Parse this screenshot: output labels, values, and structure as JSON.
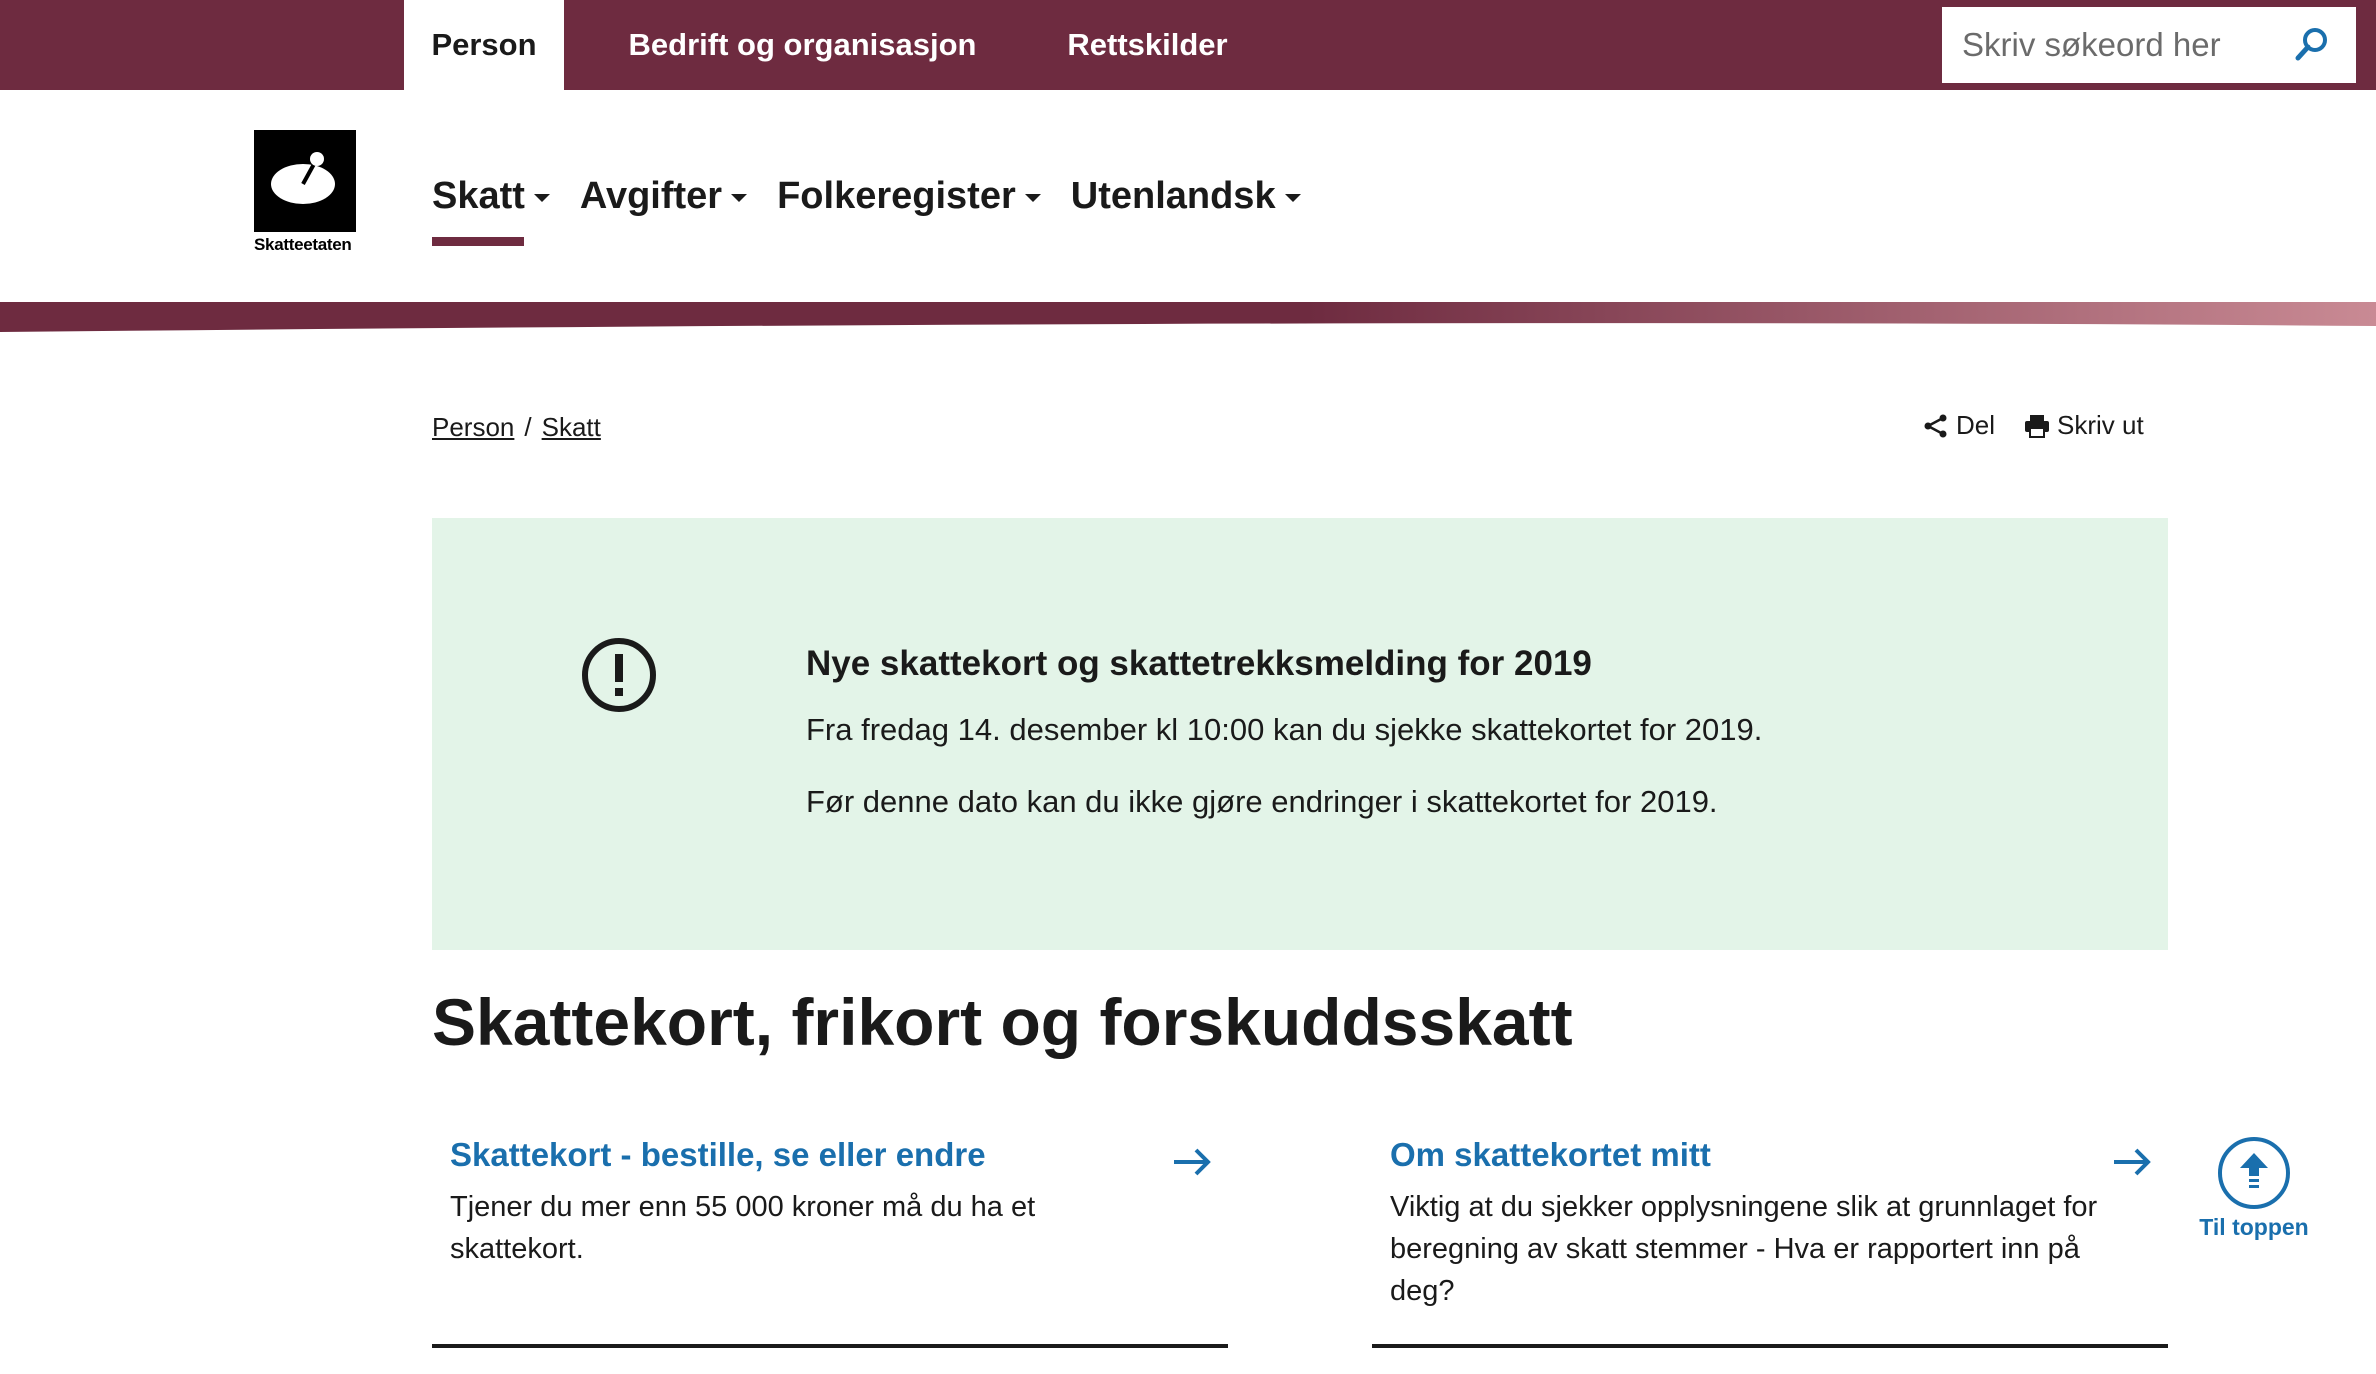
{
  "top_nav": {
    "tabs": [
      {
        "label": "Person",
        "active": true
      },
      {
        "label": "Bedrift og organisasjon",
        "active": false
      },
      {
        "label": "Rettskilder",
        "active": false
      }
    ],
    "search_placeholder": "Skriv søkeord her",
    "search_icon": "search-icon"
  },
  "logo": {
    "text": "Skatteetaten"
  },
  "main_nav": {
    "items": [
      {
        "label": "Skatt",
        "active": true
      },
      {
        "label": "Avgifter"
      },
      {
        "label": "Folkeregister"
      },
      {
        "label": "Utenlandsk"
      }
    ]
  },
  "breadcrumb": {
    "items": [
      "Person",
      "Skatt"
    ],
    "separator": "/"
  },
  "actions": {
    "share_label": "Del",
    "print_label": "Skriv ut"
  },
  "alert": {
    "icon": "exclamation-circle-icon",
    "title": "Nye skattekort og skattetrekksmelding for 2019",
    "paragraphs": [
      "Fra fredag 14. desember kl 10:00 kan du sjekke skattekortet for 2019.",
      "Før denne dato kan du ikke gjøre endringer i skattekortet for 2019."
    ]
  },
  "page_title": "Skattekort, frikort og forskuddsskatt",
  "cards": [
    {
      "title": "Skattekort - bestille, se eller endre",
      "description": "Tjener du mer enn 55 000 kroner må du ha et skattekort."
    },
    {
      "title": "Om skattekortet mitt",
      "description": "Viktig at du sjekker opplysningene slik at grunnlaget for beregning av skatt stemmer - Hva er rapportert inn på deg?"
    }
  ],
  "to_top": {
    "label": "Til toppen"
  },
  "colors": {
    "brand": "#6e2b40",
    "link": "#1a6fad",
    "alert_bg": "#e3f4e8"
  }
}
